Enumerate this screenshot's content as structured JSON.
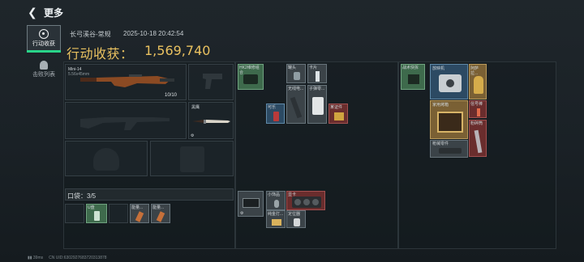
{
  "header": {
    "back_icon": "chevron-left-icon",
    "title": "更多"
  },
  "tabs": [
    {
      "label": "行动收获",
      "active": true,
      "icon": "target-icon"
    },
    {
      "label": "击败列表",
      "active": false,
      "icon": "skull-icon"
    }
  ],
  "operation": {
    "map_mode": "长弓溪谷-常规",
    "datetime": "2025-10-18 20:42:54",
    "earnings_label": "行动收获：",
    "earnings_value": "1,569,740"
  },
  "loadout": {
    "primary_weapon": {
      "name": "Mini-14",
      "sub": "5.56x45mm",
      "ammo": "10/10"
    },
    "melee": {
      "name": "黑鹰"
    }
  },
  "pocket": {
    "label": "口袋：3/5",
    "items": [
      "U盘",
      "能量...",
      "能量..."
    ]
  },
  "backpack": {
    "items": [
      "HK2维修组合",
      "罐头",
      "卡片",
      "无线电...",
      "子弹零...",
      "可乐",
      "某证件",
      "小饰品",
      "显卡",
      "纯金打...",
      "定位器"
    ]
  },
  "rig": {
    "items": [
      "战术快拆",
      "放映机",
      "阿萨拉...",
      "家用烤箱",
      "信号棒",
      "粉碎筒",
      "枪械零件"
    ]
  },
  "footer": {
    "ping": "39ms",
    "uid": "CN UID:6302927683720313878"
  },
  "colors": {
    "accent_gold": "#e9c160",
    "active_tab_indicator": "#29d489"
  }
}
